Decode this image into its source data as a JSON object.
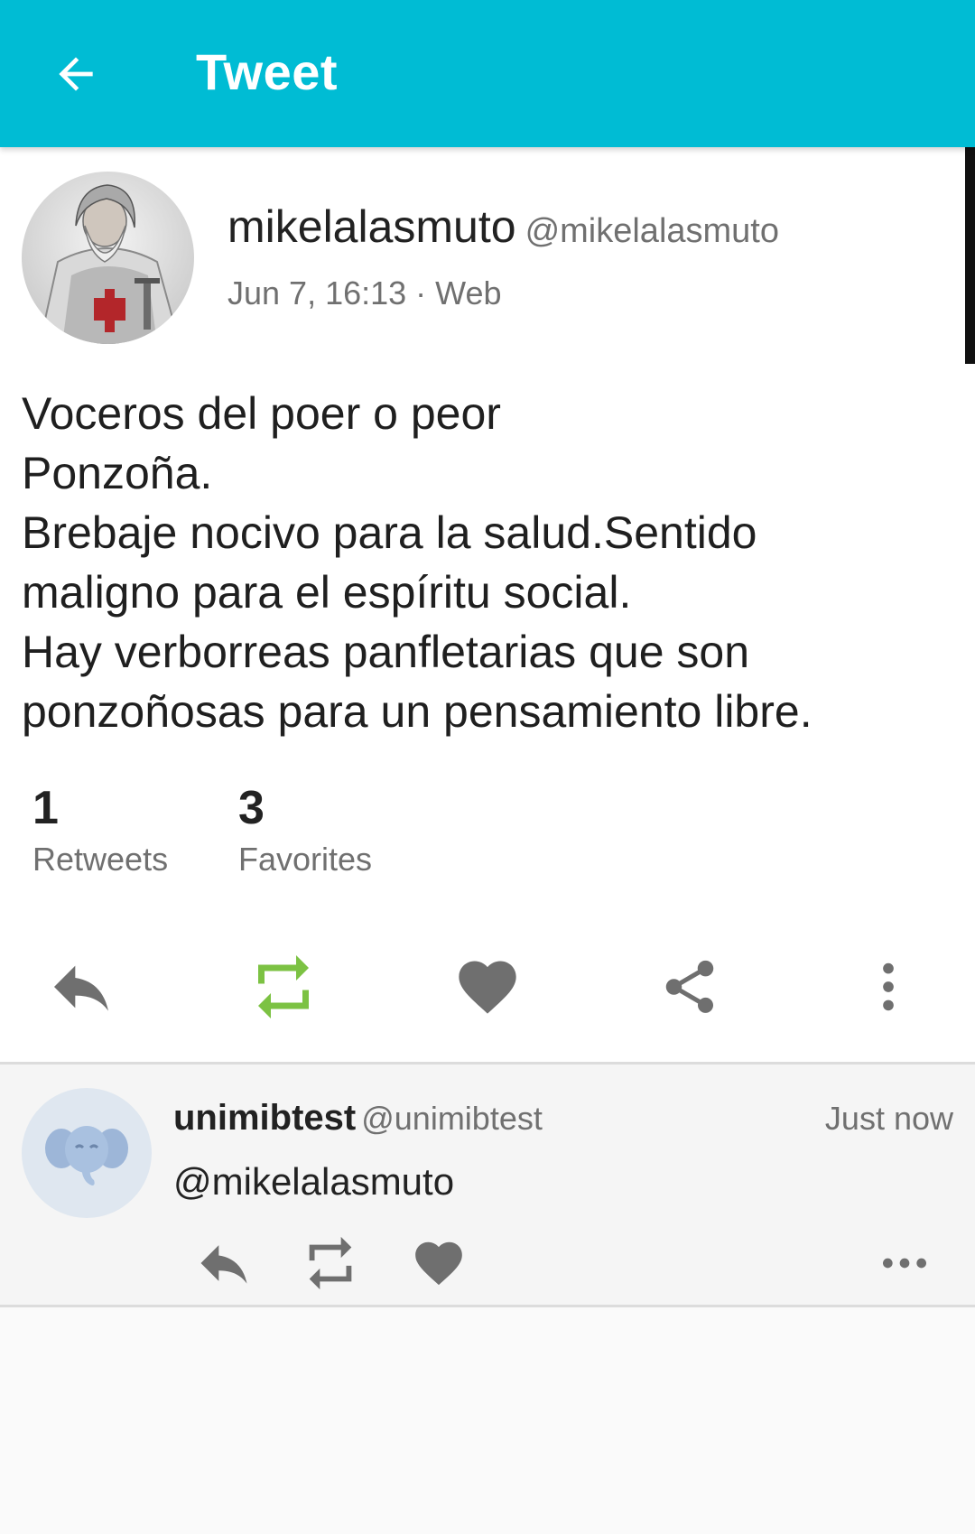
{
  "appbar": {
    "title": "Tweet",
    "background_color": "#00bcd4",
    "back_icon": "arrow-back-icon"
  },
  "tweet": {
    "author_name": "mikelalasmuto",
    "author_handle": "@mikelalasmuto",
    "meta": "Jun 7, 16:13 · Web",
    "text_lines": [
      "Voceros del poer o peor",
      "Ponzoña.",
      "Brebaje nocivo para la salud.Sentido",
      "maligno para el espíritu social.",
      "Hay verborreas panfletarias que son",
      "ponzoñosas para un pensamiento libre."
    ],
    "stats": {
      "retweets_count": "1",
      "retweets_label": "Retweets",
      "favorites_count": "3",
      "favorites_label": "Favorites"
    },
    "actions": [
      {
        "name": "reply-icon",
        "color": "#6f6f6f"
      },
      {
        "name": "retweet-icon",
        "color": "#7cc243",
        "active": true
      },
      {
        "name": "heart-icon",
        "color": "#6f6f6f"
      },
      {
        "name": "share-icon",
        "color": "#6f6f6f"
      },
      {
        "name": "more-vertical-icon",
        "color": "#6f6f6f"
      }
    ]
  },
  "reply": {
    "author_name": "unimibtest",
    "author_handle": "@unimibtest",
    "time": "Just now",
    "text": "@mikelalasmuto",
    "avatar_icon": "elephant-icon",
    "actions": [
      {
        "name": "reply-icon"
      },
      {
        "name": "retweet-icon"
      },
      {
        "name": "heart-icon"
      },
      {
        "name": "more-horizontal-icon"
      }
    ]
  }
}
